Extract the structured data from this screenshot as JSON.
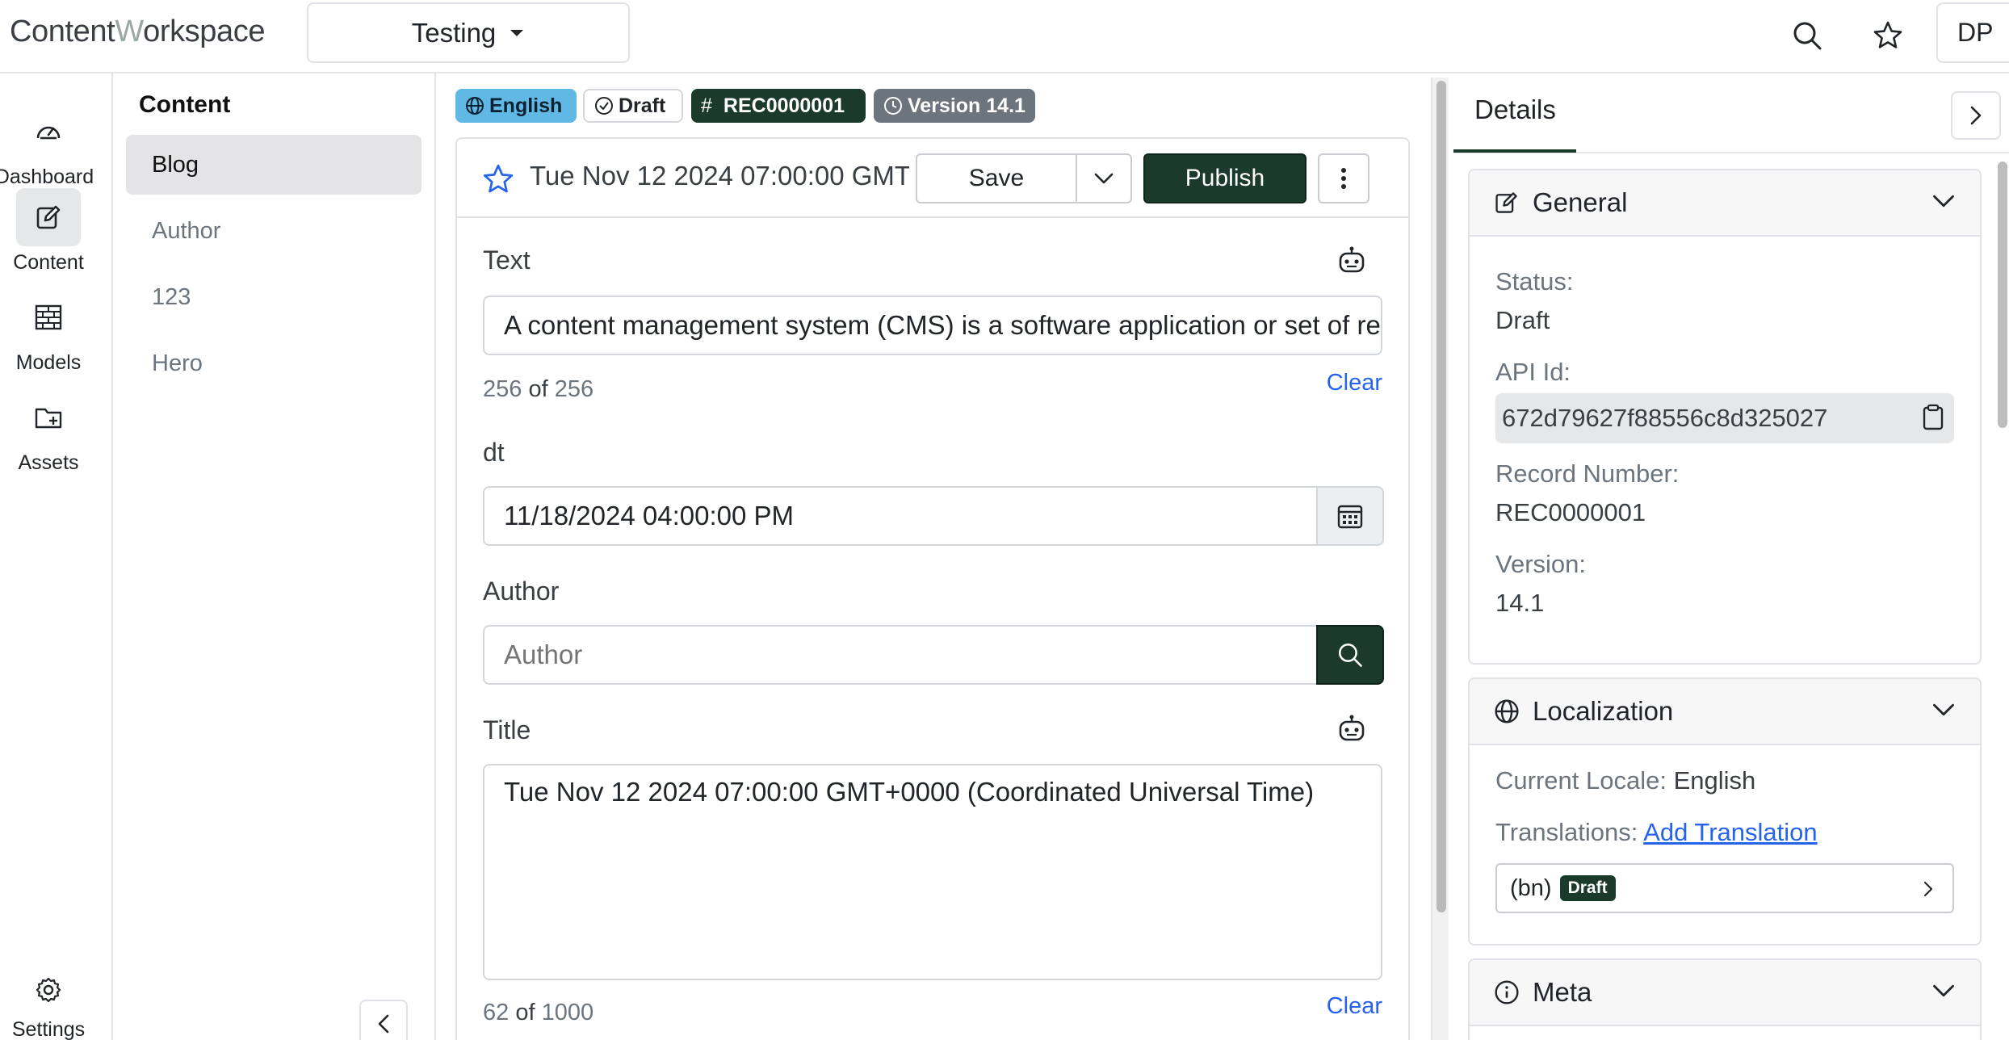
{
  "app": {
    "logo_part1": "C",
    "logo_part2": "ontent",
    "logo_part3": "W",
    "logo_part4": "orkspace",
    "space_selector": "Testing",
    "avatar_initials": "DP"
  },
  "nav": {
    "dashboard": "Dashboard",
    "content": "Content",
    "models": "Models",
    "assets": "Assets",
    "settings": "Settings"
  },
  "content_list": {
    "title": "Content",
    "items": [
      "Blog",
      "Author",
      "123",
      "Hero"
    ]
  },
  "badges": {
    "locale": "English",
    "status": "Draft",
    "record": "REC0000001",
    "version": "Version 14.1"
  },
  "editor": {
    "entry_title": "Tue Nov 12 2024 07:00:00 GMT+0000 (Coordinated Universal Time)",
    "save": "Save",
    "publish": "Publish",
    "fields": {
      "text_label": "Text",
      "text_value": "A content management system (CMS) is a software application or set of related programs",
      "text_count": "256",
      "text_of": "of",
      "text_max": "256",
      "clear": "Clear",
      "dt_label": "dt",
      "dt_value": "11/18/2024 04:00:00 PM",
      "author_label": "Author",
      "author_placeholder": "Author",
      "title_label": "Title",
      "title_value": "Tue Nov 12 2024 07:00:00 GMT+0000 (Coordinated Universal Time)",
      "title_count": "62",
      "title_of": "of",
      "title_max": "1000"
    }
  },
  "details": {
    "tab": "Details",
    "general": {
      "heading": "General",
      "status_label": "Status:",
      "status_value": "Draft",
      "api_label": "API Id:",
      "api_value": "672d79627f88556c8d325027",
      "record_label": "Record Number:",
      "record_value": "REC0000001",
      "version_label": "Version:",
      "version_value": "14.1"
    },
    "localization": {
      "heading": "Localization",
      "current_label": "Current Locale:",
      "current_value": "English",
      "translations_label": "Translations:",
      "add_translation": "Add Translation",
      "translation_locale": "(bn)",
      "translation_status": "Draft"
    },
    "meta": {
      "heading": "Meta"
    }
  },
  "colors": {
    "primary_dark": "#1b3a2c",
    "locale_badge": "#5fb9e4",
    "version_badge": "#6c757d",
    "link": "#2563eb"
  }
}
